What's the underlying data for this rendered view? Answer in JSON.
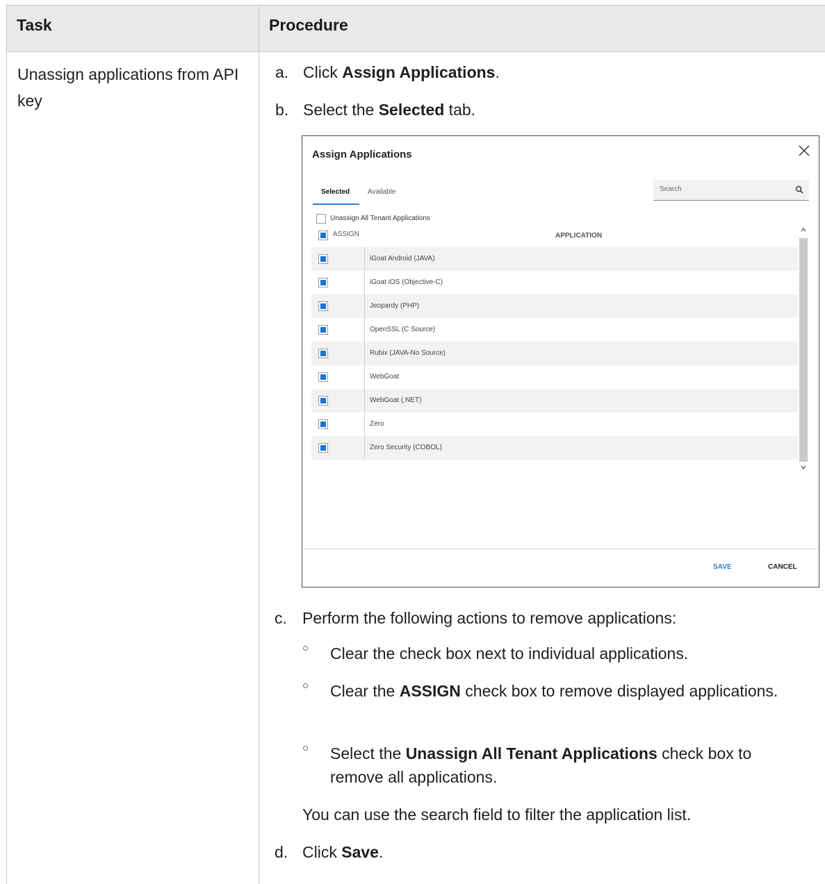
{
  "table": {
    "header": {
      "task": "Task",
      "procedure": "Procedure"
    },
    "task_text": "Unassign applications from API key",
    "steps": {
      "a": {
        "label": "a.",
        "pre": "Click ",
        "bold": "Assign Applications",
        "post": "."
      },
      "b": {
        "label": "b.",
        "pre": "Select the ",
        "bold": "Selected",
        "post": " tab."
      },
      "c": {
        "label": "c.",
        "text": "Perform the following actions to remove applications:"
      },
      "d": {
        "label": "d.",
        "pre": "Click ",
        "bold": "Save",
        "post": "."
      }
    },
    "bullets": [
      {
        "pre": "Clear the check box next to individual applications.",
        "bold": "",
        "post": ""
      },
      {
        "pre": "Clear the ",
        "bold": "ASSIGN",
        "post": " check box to remove displayed applications."
      },
      {
        "pre": "Select the ",
        "bold": "Unassign All Tenant Applications",
        "post": " check box to remove all applications."
      }
    ],
    "note": "You can use the search field to filter the application list."
  },
  "dialog": {
    "title": "Assign Applications",
    "tabs": {
      "selected": "Selected",
      "available": "Available"
    },
    "search_placeholder": "Search",
    "unassign_all_label": "Unassign All Tenant Applications",
    "assign_label": "ASSIGN",
    "column_application": "APPLICATION",
    "applications": [
      "iGoat Android (JAVA)",
      "iGoat iOS (Objective-C)",
      "Jeopardy (PHP)",
      "OpenSSL (C Source)",
      "Rubix (JAVA-No Source)",
      "WebGoat",
      "WebGoat (.NET)",
      "Zero",
      "Zero Security (COBOL)"
    ],
    "save_label": "SAVE",
    "cancel_label": "CANCEL",
    "accent_color": "#2e7bd6",
    "checkbox_color": "#1a73d9"
  }
}
